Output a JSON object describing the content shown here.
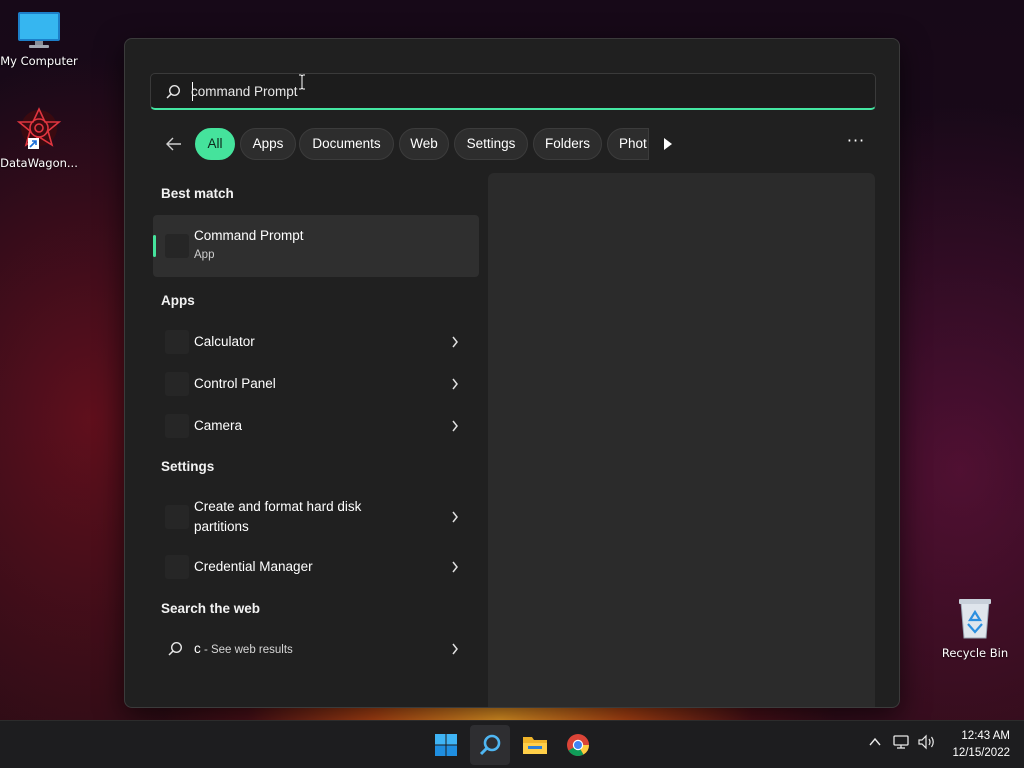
{
  "desktop": {
    "icons": [
      {
        "label": "My Computer"
      },
      {
        "label": "DataWagon..."
      },
      {
        "label": "Recycle Bin"
      }
    ]
  },
  "search": {
    "query": "command Prompt",
    "filters": [
      {
        "label": "All",
        "active": true
      },
      {
        "label": "Apps"
      },
      {
        "label": "Documents"
      },
      {
        "label": "Web"
      },
      {
        "label": "Settings"
      },
      {
        "label": "Folders"
      },
      {
        "label": "Phot"
      }
    ],
    "accent_color": "#45e39c"
  },
  "results": {
    "best_match": {
      "heading": "Best match",
      "title": "Command Prompt",
      "subtitle": "App"
    },
    "apps": {
      "heading": "Apps",
      "items": [
        "Calculator",
        "Control Panel",
        "Camera"
      ]
    },
    "settings": {
      "heading": "Settings",
      "items": [
        {
          "line1": "Create and format hard disk",
          "line2": "partitions"
        },
        {
          "line1": "Credential Manager"
        }
      ]
    },
    "web": {
      "heading": "Search the web",
      "query": "c",
      "suffix": " - See web results"
    }
  },
  "taskbar": {
    "apps": [
      "start-icon",
      "search-icon",
      "file-explorer-icon",
      "chrome-icon"
    ],
    "clock": {
      "time": "12:43 AM",
      "date": "12/15/2022"
    }
  }
}
